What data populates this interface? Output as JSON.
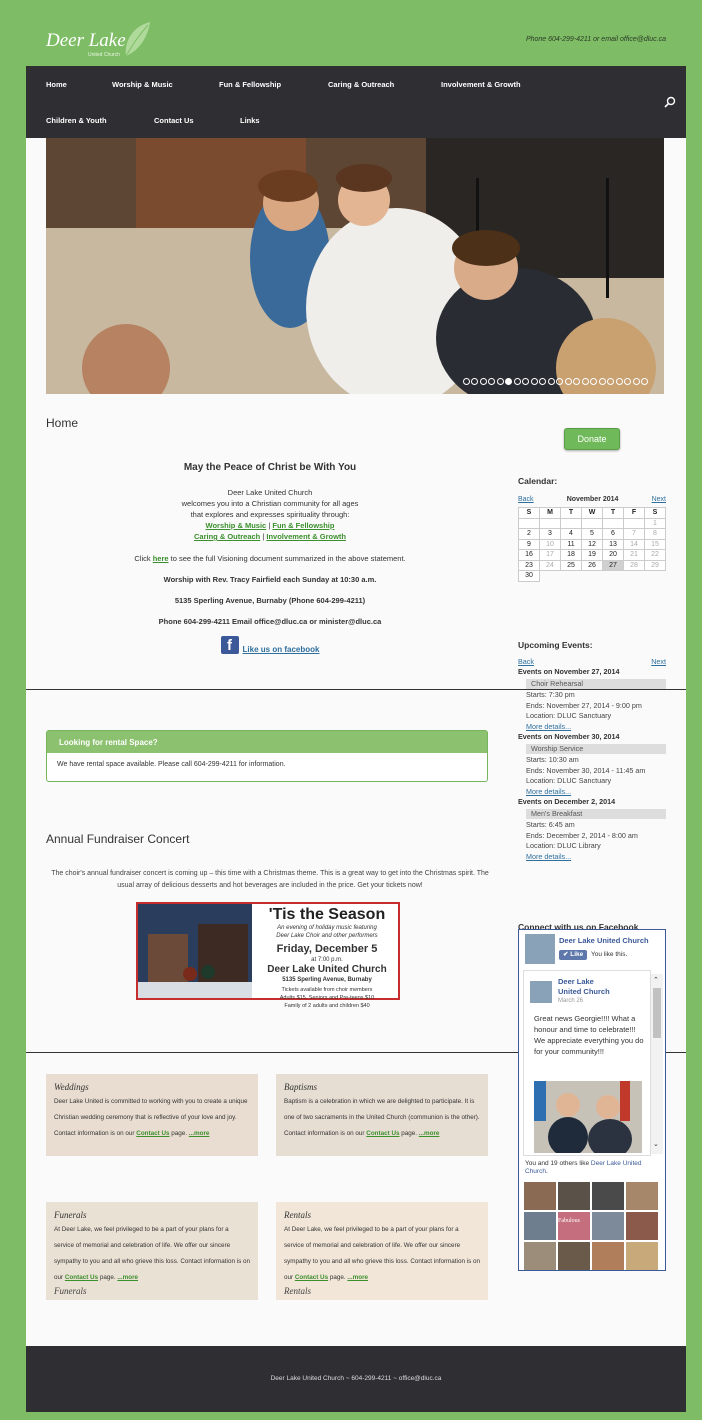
{
  "header": {
    "logo": "Deer Lake",
    "logo_sub": "United Church",
    "contact": "Phone 604-299-4211 or email office@dluc.ca"
  },
  "nav": {
    "items": [
      "Home",
      "Worship & Music",
      "Fun & Fellowship",
      "Caring & Outreach",
      "Involvement & Growth",
      "Children & Youth",
      "Contact Us",
      "Links"
    ]
  },
  "slider": {
    "count": 22,
    "active": 5
  },
  "page_title": "Home",
  "intro": {
    "heading": "May the Peace of Christ be With You",
    "l1": "Deer Lake United Church",
    "l2": "welcomes you into a Christian community for all ages",
    "l3": "that explores and expresses spirituality through:",
    "link1": "Worship & Music",
    "link2": "Fun & Fellowship",
    "link3": "Caring & Outreach",
    "link4": "Involvement & Growth",
    "click_pre": "Click ",
    "click_link": "here",
    "click_post": " to see the full Visioning document summarized in the above statement.",
    "worship": "Worship with Rev. Tracy Fairfield each Sunday at 10:30 a.m.",
    "address": "5135 Sperling Avenue, Burnaby (Phone 604-299-4211)",
    "phone": "Phone 604-299-4211 Email office@dluc.ca or minister@dluc.ca",
    "fb_link": "Like us on facebook"
  },
  "rental_box": {
    "title": "Looking for rental Space?",
    "body": "We have rental space available. Please call 604-299-4211 for information."
  },
  "concert": {
    "title": "Annual Fundraiser Concert",
    "body": "The choir's annual fundraiser concert is coming up – this time with a Christmas theme. This is a great way to get into the Christmas spirit. The usual array of delicious desserts and hot beverages are included in the price. Get your tickets now!",
    "poster": {
      "title": "'Tis the Season",
      "sub1": "An evening of holiday music featuring",
      "sub2": "Deer Lake Choir and other performers",
      "date": "Friday, December 5",
      "time": "at 7:00 p.m.",
      "venue": "Deer Lake United Church",
      "address": "5135 Sperling Avenue, Burnaby",
      "tix": "Tickets available from choir members",
      "prices1": "Adults $15, Seniors and Pre-teens $10",
      "prices2": "Family of 2 adults and children $40"
    }
  },
  "cards": [
    {
      "title": "Weddings",
      "body": "Deer Lake United is committed to working with you to create a unique Christian wedding ceremony that is reflective of your love and joy. Contact information is on our ",
      "link": "Contact Us",
      "post": " page. ",
      "more": "...more"
    },
    {
      "title": "Baptisms",
      "body": "Baptism is a celebration in which we are delighted to participate. It is one of two sacraments in the United Church (communion is the other). Contact information is on our ",
      "link": "Contact Us",
      "post": " page. ",
      "more": "...more"
    },
    {
      "title": "Funerals",
      "body": "At Deer Lake, we feel privileged to be a part of your plans for a service of memorial and celebration of life. We offer our sincere sympathy to you and all who grieve this loss. Contact information is on our ",
      "link": "Contact Us",
      "post": " page. ",
      "more": "...more",
      "ghost": "Funerals"
    },
    {
      "title": "Rentals",
      "body": "At Deer Lake, we feel privileged to be a part of your plans for a service of memorial and celebration of life. We offer our sincere sympathy to you and all who grieve this loss. Contact information is on our ",
      "link": "Contact Us",
      "post": " page. ",
      "more": "...more",
      "ghost": "Rentals"
    }
  ],
  "sidebar": {
    "donate": "Donate",
    "calendar_title": "Calendar:",
    "back": "Back",
    "next": "Next",
    "month": "November 2014",
    "days": [
      "S",
      "M",
      "T",
      "W",
      "T",
      "F",
      "S"
    ],
    "events_title": "Upcoming Events:",
    "events": [
      {
        "date": "Events on November 27, 2014",
        "name": "Choir Rehearsal",
        "starts": "Starts: 7:30 pm",
        "ends": "Ends: November 27, 2014 - 9:00 pm",
        "loc": "Location: DLUC Sanctuary",
        "more": "More details..."
      },
      {
        "date": "Events on November 30, 2014",
        "name": "Worship Service",
        "starts": "Starts: 10:30 am",
        "ends": "Ends: November 30, 2014 - 11:45 am",
        "loc": "Location: DLUC Sanctuary",
        "more": "More details..."
      },
      {
        "date": "Events on December 2, 2014",
        "name": "Men's Breakfast",
        "starts": "Starts: 6:45 am",
        "ends": "Ends: December 2, 2014 - 8:00 am",
        "loc": "Location: DLUC Library",
        "more": "More details..."
      }
    ],
    "connect_title": "Connect with us on Facebook",
    "fb": {
      "page": "Deer Lake United Church",
      "like": "Like",
      "you_like": "You like this.",
      "post_author1": "Deer Lake",
      "post_author2": "United Church",
      "post_date": "March 26",
      "post_text": "Great news Georgie!!!! What a honour and time to celebrate!!! We appreciate everything you do for your community!!!",
      "likes_pre": "You and 19 others like ",
      "likes_link": "Deer Lake United Church",
      "likes_post": ".",
      "fabulous": "Fabulous"
    }
  },
  "footer": "Deer Lake United Church ~ 604-299-4211 ~ office@dluc.ca"
}
